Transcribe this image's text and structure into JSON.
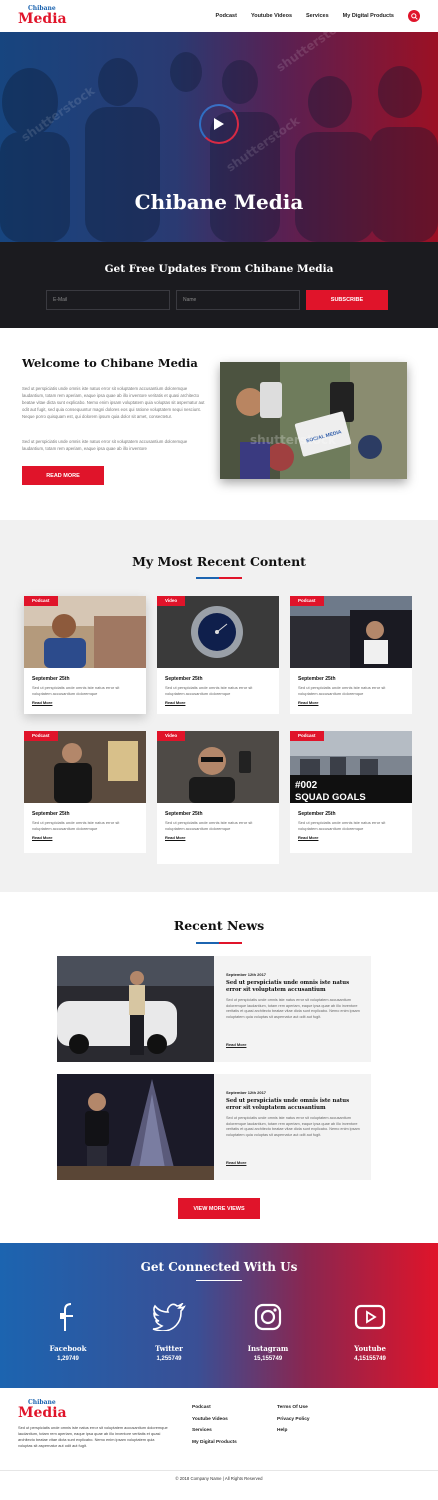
{
  "header": {
    "logo_small": "Chibane",
    "logo_big": "Media",
    "nav": [
      "Podcast",
      "Youtube Videos",
      "Services",
      "My Digital Products"
    ]
  },
  "hero": {
    "title": "Chibane Media",
    "watermark": "shutterstock"
  },
  "subscribe": {
    "title": "Get Free Updates From Chibane Media",
    "email_placeholder": "E-Mail",
    "name_placeholder": "Name",
    "button": "SUBSCRIBE"
  },
  "welcome": {
    "title": "Welcome to Chibane Media",
    "p1": "Sed ut perspiciatis unde omnis iste natus error sit voluptatem accusantium doloremque laudantium, totam rem aperiam, eaque ipsa quae ab illo inventore veritatis et quasi architecto beatae vitae dicta sunt explicabo. Nemo enim ipsam voluptatem quia voluptas sit aspernatur aut odit aut fugit, sed quia consequuntur magni dolores eos qui ratione voluptatem sequi nesciunt. Neque porro quisquam est, qui dolorem ipsum quia dolor sit amet, consectetur.",
    "p2": "Sed ut perspiciatis unde omnis iste natus error sit voluptatem accusantium doloremque laudantium, totam rem aperiam, eaque ipsa quae ab illo inventore",
    "button": "READ MORE",
    "image_text": "SOCIAL MEDIA"
  },
  "recent_content": {
    "title": "My Most Recent Content",
    "cards": [
      {
        "tag": "Podcast",
        "date": "September 25th",
        "desc": "Sed ut perspiciatis unde omnis iste natus error sit voluptatem accusantium doloremque",
        "more": "Read More"
      },
      {
        "tag": "Video",
        "date": "September 25th",
        "desc": "Sed ut perspiciatis unde omnis iste natus error sit voluptatem accusantium doloremque",
        "more": "Read More"
      },
      {
        "tag": "Podcast",
        "date": "September 25th",
        "desc": "Sed ut perspiciatis unde omnis iste natus error sit voluptatem accusantium doloremque",
        "more": "Read More"
      },
      {
        "tag": "Podcast",
        "date": "September 25th",
        "desc": "Sed ut perspiciatis unde omnis iste natus error sit voluptatem accusantium doloremque",
        "more": "Read More"
      },
      {
        "tag": "Video",
        "date": "September 25th",
        "desc": "Sed ut perspiciatis unde omnis iste natus error sit voluptatem accusantium doloremque",
        "more": "Read More"
      },
      {
        "tag": "Podcast",
        "date": "September 25th",
        "desc": "Sed ut perspiciatis unde omnis iste natus error sit voluptatem accusantium doloremque",
        "more": "Read More"
      }
    ],
    "squad_line1": "#002",
    "squad_line2": "SQUAD GOALS"
  },
  "news": {
    "title": "Recent News",
    "items": [
      {
        "date": "September 12th 2017",
        "title": "Sed ut perspiciatis unde omnis iste natus error sit voluptatem accusantium",
        "body": "Sed ut perspiciatis unde omnis iste natus error sit voluptatem accusantium doloremque laudantium, totam rem aperiam, eaque ipsa quae ab illo inventore veritatis et quasi architecto beatae vitae dicta sunt explicabo. Nemo enim ipsam voluptatem quia voluptas sit aspernatur aut odit aut fugit.",
        "more": "Read More"
      },
      {
        "date": "September 12th 2017",
        "title": "Sed ut perspiciatis unde omnis iste natus error sit voluptatem accusantium",
        "body": "Sed ut perspiciatis unde omnis iste natus error sit voluptatem accusantium doloremque laudantium, totam rem aperiam, eaque ipsa quae ab illo inventore veritatis et quasi architecto beatae vitae dicta sunt explicabo. Nemo enim ipsam voluptatem quia voluptas sit aspernatur aut odit aut fugit.",
        "more": "Read More"
      }
    ],
    "button": "VIEW MORE VIEWS"
  },
  "social": {
    "title": "Get Connected With Us",
    "items": [
      {
        "name": "Facebook",
        "count": "1,29749",
        "icon": "facebook-icon"
      },
      {
        "name": "Twitter",
        "count": "1,255749",
        "icon": "twitter-icon"
      },
      {
        "name": "Instagram",
        "count": "15,155749",
        "icon": "instagram-icon"
      },
      {
        "name": "Youtube",
        "count": "4,15155749",
        "icon": "youtube-icon"
      }
    ]
  },
  "footer": {
    "logo_small": "Chibane",
    "logo_big": "Media",
    "text": "Sed ut perspiciatis unde omnis iste natus error sit voluptatem accusantium doloremque laudantium, totam rem aperiam, eaque ipsa quae ab illo inventore veritatis et quasi architecto beatae vitae dicta sunt explicabo. Nemo enim ipsam voluptatem quia voluptas sit aspernatur aut odit aut fugit.",
    "col1": [
      "Podcast",
      "Youtube Videos",
      "Services",
      "My Digital Products"
    ],
    "col2": [
      "Terms Of Use",
      "Privacy Policy",
      "Help"
    ],
    "copyright": "© 2018 Company Name | All Rights Reserved"
  },
  "colors": {
    "red": "#e0142a",
    "blue": "#1c64b0",
    "dark": "#1b1b1f"
  }
}
